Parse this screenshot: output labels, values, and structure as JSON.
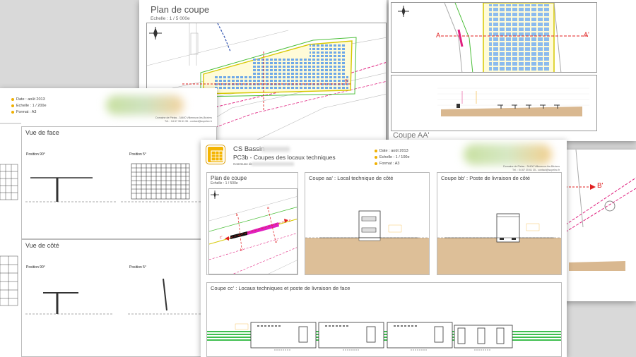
{
  "sheet_plan": {
    "title": "Plan de coupe",
    "scale": "Echelle : 1 / 5 000e",
    "marker_b": "B'"
  },
  "sheet_coupe_aa": {
    "title": "Coupe AA'",
    "marker_a_left": "A",
    "marker_a_right": "A'",
    "marker_b": "B'"
  },
  "sheet_vues": {
    "meta": {
      "date": "Date : août 2013",
      "scale": "Echelle : 1 / 200e",
      "format": "Format : A3"
    },
    "address_line1": "Domaine de Pielas - 34400 Villeneuve-lès-Béziers",
    "address_line2": "Tél. : 04 67 35 61 35 - contact@supelec.fr",
    "vue_face": {
      "title": "Vue de face",
      "pos_90": "Position 90°",
      "pos_5": "Position 5°"
    },
    "vue_cote": {
      "title": "Vue de côté",
      "pos_90": "Position 90°",
      "pos_5": "Position 5°"
    }
  },
  "main_sheet": {
    "project": "CS Bassin",
    "subtitle": "PC3b - Coupes des locaux techniques",
    "commune_label": "Commune de",
    "meta": {
      "date": "Date : août 2013",
      "scale": "Echelle : 1 / 100e",
      "format": "Format : A3"
    },
    "address_line1": "Domaine de Pielas - 34400 Villeneuve-lès-Béziers",
    "address_line2": "Tél. : 04 67 35 61 35 - contact@supelec.fr",
    "plan_coupe": {
      "title": "Plan de coupe",
      "scale": "Echelle : 1 / 500e",
      "labels": {
        "a": "a",
        "a_prime": "a'",
        "b": "b",
        "b_prime": "b'",
        "c": "c",
        "c_prime": "c'"
      }
    },
    "coupe_aa": {
      "title": "Coupe aa' : Local technique de côté"
    },
    "coupe_bb": {
      "title": "Coupe bb' : Poste de livraison de côté"
    },
    "coupe_cc": {
      "title": "Coupe cc' : Locaux techniques et poste de livraison de face"
    }
  },
  "colors": {
    "accent_magenta": "#e0207f",
    "marker_red": "#e02020",
    "pv_blue": "#6ea8e8",
    "ground_tan": "#d9b890",
    "grass_green": "#3fbf4f",
    "meta_bullet": "#f0b000",
    "icon_yellow": "#f4b400"
  },
  "icons": [
    "north-arrow-icon",
    "building-icon"
  ]
}
